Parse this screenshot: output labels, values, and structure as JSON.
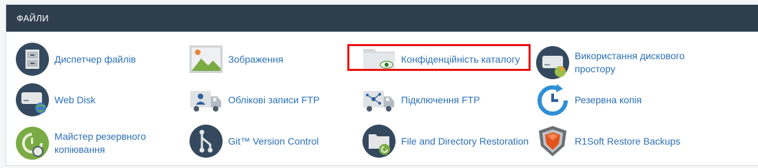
{
  "section": {
    "title": "ФАЙЛИ"
  },
  "items": [
    {
      "label": "Диспетчер файлів",
      "icon": "file-cabinet-icon"
    },
    {
      "label": "Зображення",
      "icon": "image-icon"
    },
    {
      "label": "Конфіденційність каталогу",
      "icon": "folder-eye-icon"
    },
    {
      "label": "Використання дискового простору",
      "icon": "disk-usage-icon"
    },
    {
      "label": "Web Disk",
      "icon": "web-disk-icon"
    },
    {
      "label": "Облікові записи FTP",
      "icon": "ftp-accounts-icon"
    },
    {
      "label": "Підключення FTP",
      "icon": "ftp-connections-icon"
    },
    {
      "label": "Резервна копія",
      "icon": "backup-icon"
    },
    {
      "label": "Майстер резервного копіювання",
      "icon": "backup-wizard-icon"
    },
    {
      "label": "Git™ Version Control",
      "icon": "git-icon"
    },
    {
      "label": "File and Directory Restoration",
      "icon": "folder-restore-icon"
    },
    {
      "label": "R1Soft Restore Backups",
      "icon": "r1soft-shield-icon"
    }
  ],
  "colors": {
    "header": "#2e3e4d",
    "link": "#2b70b6",
    "highlight": "#ee1111"
  }
}
